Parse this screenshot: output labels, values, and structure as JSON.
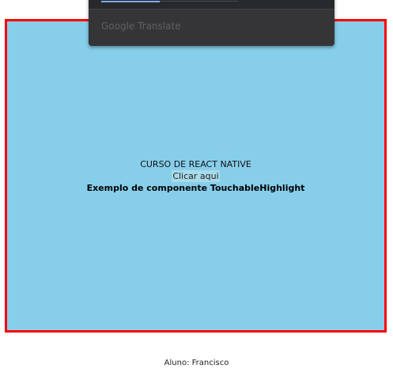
{
  "app": {
    "title": "CURSO DE REACT NATIVE",
    "button_label": "Clicar aqui",
    "subtitle": "Exemplo de componente TouchableHighlight",
    "footer": "Aluno: Francisco"
  },
  "translate_popup": {
    "brand": "Google Translate",
    "progress": 0.43
  }
}
